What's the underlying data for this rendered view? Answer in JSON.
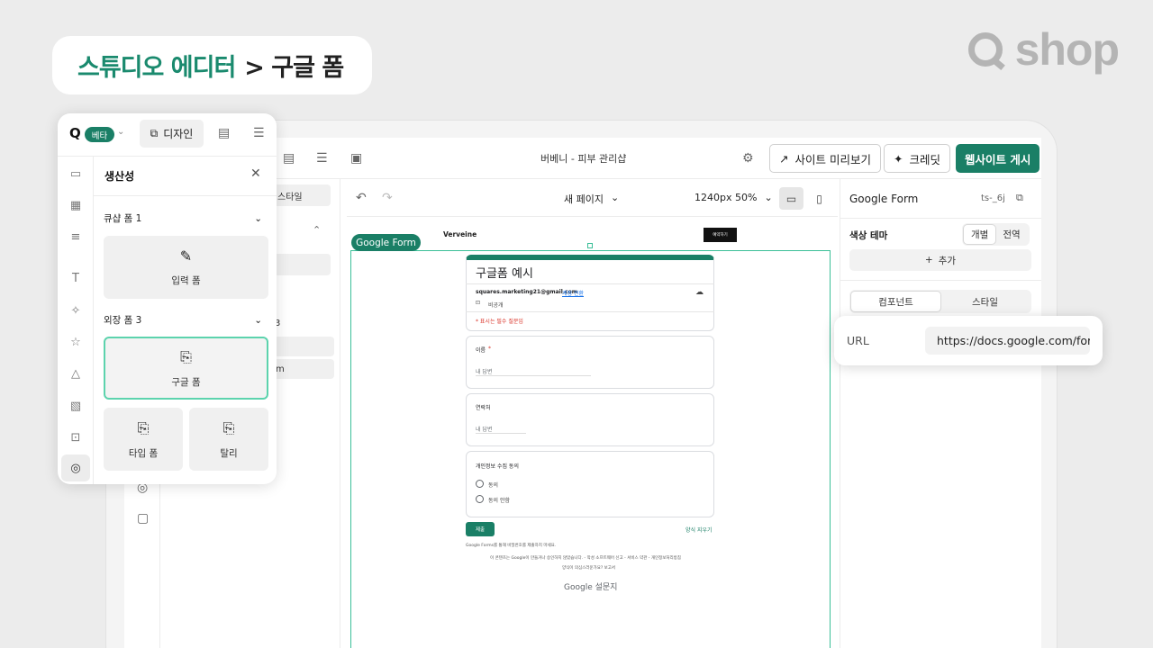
{
  "header": {
    "title_part1": "스튜디오 에디터",
    "title_part2": "> 구글 폼",
    "brand": "shop"
  },
  "topbar": {
    "site_name": "버베니 - 피부 관리샵",
    "preview_label": "사이트 미리보기",
    "credit_label": "크레딧",
    "publish_label": "웹사이트 게시"
  },
  "subbar": {
    "page_label": "새 페이지",
    "size_label": "1240px 50%"
  },
  "layers": {
    "style_tab": "스타일",
    "row_suffix": "3",
    "row_partial": "m"
  },
  "canvas": {
    "tag": "Google Form",
    "site_logo": "Verveine",
    "site_cta": "예약하기",
    "form": {
      "title": "구글폼 예시",
      "account": "squares.marketing21@gmail.com",
      "switch_account": "계정 전환",
      "private": "비공개",
      "required_note": "* 표시는 필수 질문임",
      "q1": "이름",
      "q1_star": "*",
      "answer_ph": "내 답변",
      "q2": "연락처",
      "q3": "개인정보 수집 동의",
      "opt_yes": "동의",
      "opt_no": "동의 안함",
      "submit": "제출",
      "clear": "양식 지우기",
      "footer1": "Google Forms를 통해 비밀번호를 제출하지 마세요.",
      "footer2": "이 콘텐츠는 Google이 만들거나 승인하지 않았습니다. - 악성 소프트웨어 신고 - 서비스 약관 - 개인정보처리방침",
      "footer3": "양식이 의심스러운가요? 보고서",
      "footer_logo": "Google 설문지"
    }
  },
  "right_panel": {
    "title": "Google Form",
    "id": "ts-_6j",
    "color_theme_label": "색상 테마",
    "seg_individual": "개별",
    "seg_global": "전역",
    "add_label": "추가",
    "tab_component": "컴포넌트",
    "tab_style": "스타일",
    "url_label": "URL",
    "url_value": "https://docs.google.com/forms"
  },
  "productivity": {
    "beta": "베타",
    "design_tab": "디자인",
    "title": "생산성",
    "section1": "큐샵 폼 1",
    "tile_input": "입력 폼",
    "section2": "외장 폼 3",
    "tile_google": "구글 폼",
    "tile_typeform": "타입 폼",
    "tile_tally": "탈리"
  },
  "colors": {
    "accent": "#1a7f66",
    "accent_light": "#5cd3ad",
    "title_green": "#1a8a6e"
  }
}
